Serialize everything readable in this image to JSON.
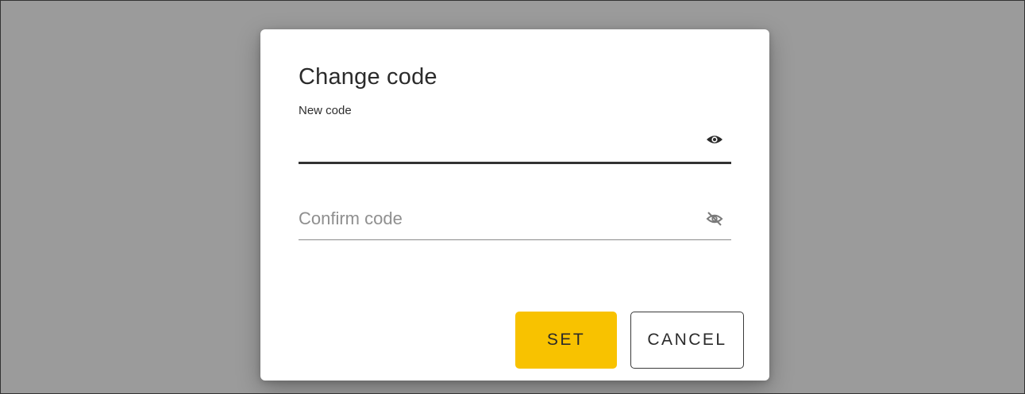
{
  "dialog": {
    "title": "Change code",
    "new_code": {
      "label": "New code",
      "value": "",
      "visibility_icon": "eye-icon",
      "visibility_state": "visible"
    },
    "confirm_code": {
      "placeholder": "Confirm code",
      "value": "",
      "visibility_icon": "eye-off-icon",
      "visibility_state": "hidden"
    },
    "buttons": {
      "set_label": "SET",
      "cancel_label": "CANCEL"
    }
  },
  "colors": {
    "overlay": "#9b9b9b",
    "dialog_bg": "#ffffff",
    "primary_button": "#f8c200",
    "text": "#2b2b2b",
    "placeholder": "#8f8f8f"
  }
}
